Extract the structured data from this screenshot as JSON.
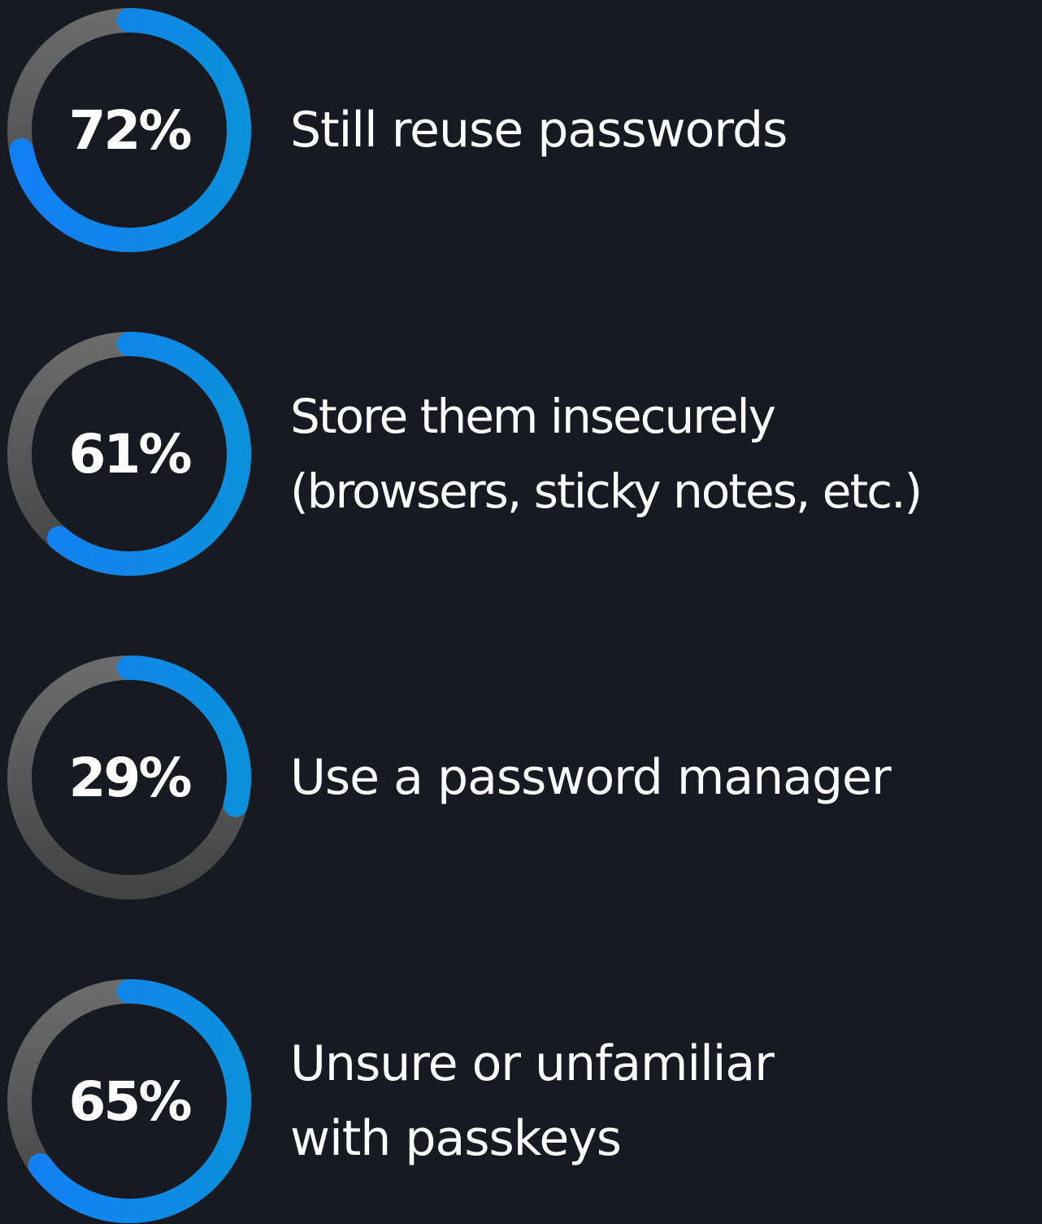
{
  "colors": {
    "background": "#171a21",
    "track_light": "#6b6b6b",
    "track_dark": "#444444",
    "arc_start": "#137ff5",
    "arc_end": "#0b90dc",
    "text": "#ffffff"
  },
  "chart_data": {
    "type": "donut",
    "unit": "%",
    "max": 100,
    "items": [
      {
        "value": 72,
        "value_label": "72%",
        "label_lines": [
          "Still reuse passwords"
        ]
      },
      {
        "value": 61,
        "value_label": "61%",
        "label_lines": [
          "Store them insecurely",
          "(browsers, sticky notes, etc.)"
        ]
      },
      {
        "value": 29,
        "value_label": "29%",
        "label_lines": [
          "Use a password manager"
        ]
      },
      {
        "value": 65,
        "value_label": "65%",
        "label_lines": [
          "Unsure or unfamiliar",
          "with passkeys"
        ]
      }
    ]
  }
}
